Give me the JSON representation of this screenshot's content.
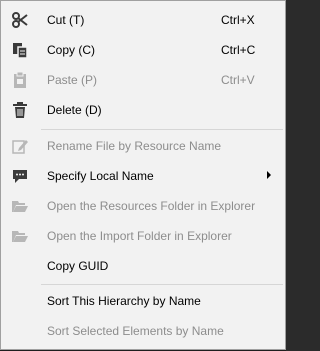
{
  "menu": {
    "cut_label": "Cut (T)",
    "cut_shortcut": "Ctrl+X",
    "copy_label": "Copy (C)",
    "copy_shortcut": "Ctrl+C",
    "paste_label": "Paste (P)",
    "paste_shortcut": "Ctrl+V",
    "delete_label": "Delete (D)",
    "rename_label": "Rename File by Resource Name",
    "specify_label": "Specify Local Name",
    "open_resources_label": "Open the Resources Folder in Explorer",
    "open_import_label": "Open the Import Folder in Explorer",
    "copy_guid_label": "Copy GUID",
    "sort_hierarchy_label": "Sort This Hierarchy by Name",
    "sort_selected_label": "Sort Selected Elements by Name"
  },
  "icons": {
    "cut": "scissors-icon",
    "copy": "copy-icon",
    "paste": "clipboard-icon",
    "delete": "trash-icon",
    "rename": "edit-icon",
    "specify": "comment-icon",
    "open_resources": "folder-open-icon",
    "open_import": "folder-open-icon"
  },
  "colors": {
    "menu_background": "#f2f2f2",
    "enabled_text": "#000000",
    "disabled_text": "#8d8d8d",
    "separator": "#d6d6d6",
    "enabled_icon": "#3a3a3a",
    "disabled_icon": "#b7b7b7"
  }
}
